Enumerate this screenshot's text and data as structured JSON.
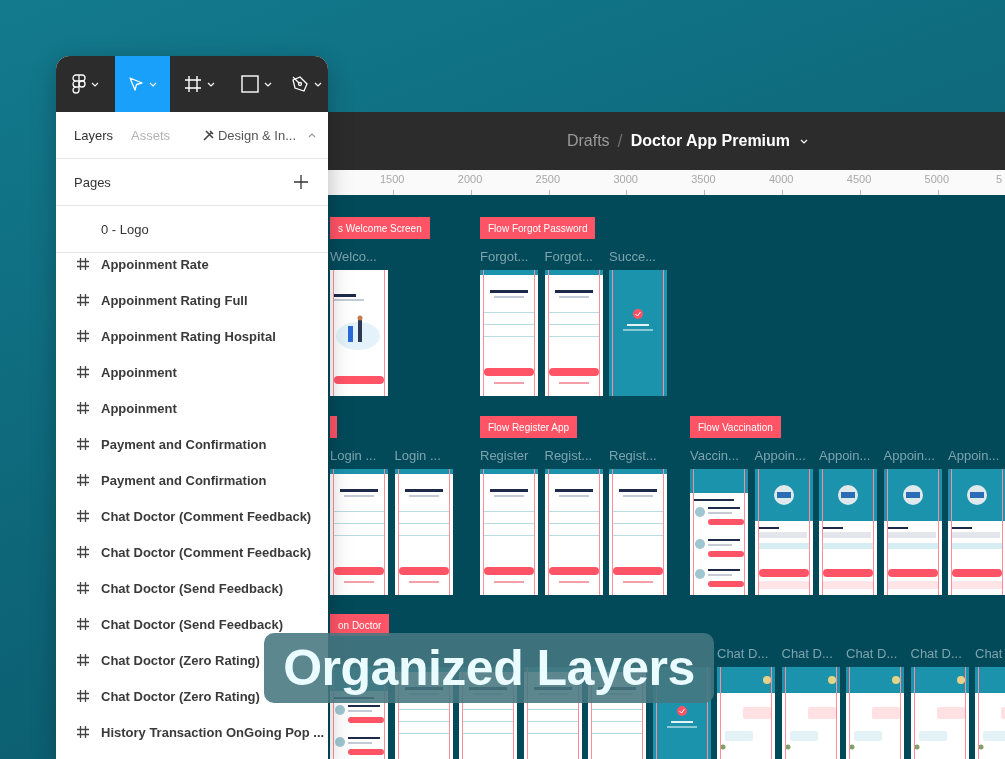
{
  "toolbar": {
    "tools": [
      {
        "kind": "logo",
        "selected": false
      },
      {
        "kind": "move",
        "selected": true
      },
      {
        "kind": "frame",
        "selected": false
      },
      {
        "kind": "shape",
        "selected": false
      },
      {
        "kind": "pen",
        "selected": false
      }
    ]
  },
  "panel": {
    "tabs": [
      {
        "label": "Layers",
        "selected": true
      },
      {
        "label": "Assets",
        "selected": false
      }
    ],
    "plugin_menu": "Design & In...",
    "pages_heading": "Pages",
    "pages": [
      "0 - Logo"
    ],
    "layers": [
      "Appoinment Rate",
      "Appoinment Rating Full",
      "Appoinment Rating Hospital",
      "Appoinment",
      "Appoinment",
      "Payment and Confirmation",
      "Payment and Confirmation",
      "Chat Doctor (Comment Feedback)",
      "Chat Doctor (Comment Feedback)",
      "Chat Doctor (Send Feedback)",
      "Chat Doctor (Send Feedback)",
      "Chat Doctor (Zero Rating)",
      "Chat Doctor (Zero Rating)",
      "History Transaction OnGoing Pop ..."
    ]
  },
  "breadcrumb": {
    "folder": "Drafts",
    "separator": "/",
    "file": "Doctor App Premium"
  },
  "ruler": [
    "1500",
    "2000",
    "2500",
    "3000",
    "3500",
    "4000",
    "4500",
    "5000",
    "5"
  ],
  "sections": [
    {
      "label": "s Welcome Screen",
      "frames": [
        {
          "title": "Welco...",
          "kind": "welcome"
        }
      ]
    },
    {
      "label": "Flow Forgot Password",
      "frames": [
        {
          "title": "Forgot...",
          "kind": "form"
        },
        {
          "title": "Forgot...",
          "kind": "form"
        },
        {
          "title": "Succe...",
          "kind": "success"
        }
      ]
    },
    {
      "frames": [
        {
          "title": "Login ...",
          "kind": "form"
        },
        {
          "title": "Login ...",
          "kind": "form"
        }
      ]
    },
    {
      "label": "Flow Register App",
      "frames": [
        {
          "title": "Register",
          "kind": "form"
        },
        {
          "title": "Regist...",
          "kind": "form"
        },
        {
          "title": "Regist...",
          "kind": "form"
        }
      ]
    },
    {
      "label": "Flow Vaccination",
      "frames": [
        {
          "title": "Vaccin...",
          "kind": "list"
        },
        {
          "title": "Appoin...",
          "kind": "profile"
        },
        {
          "title": "Appoin...",
          "kind": "profile"
        },
        {
          "title": "Appoin...",
          "kind": "profile"
        },
        {
          "title": "Appoin...",
          "kind": "profile"
        }
      ]
    },
    {
      "label": "on Doctor",
      "frames": [
        {
          "kind": "list"
        },
        {
          "kind": "form"
        },
        {
          "kind": "form"
        },
        {
          "kind": "form"
        },
        {
          "kind": "form"
        },
        {
          "kind": "success"
        },
        {
          "title": "Chat D...",
          "kind": "chat"
        },
        {
          "title": "Chat D...",
          "kind": "chat"
        },
        {
          "title": "Chat D...",
          "kind": "chat"
        },
        {
          "title": "Chat D...",
          "kind": "chat"
        },
        {
          "title": "Chat",
          "kind": "chat"
        }
      ]
    }
  ],
  "banner": "Organized Layers"
}
